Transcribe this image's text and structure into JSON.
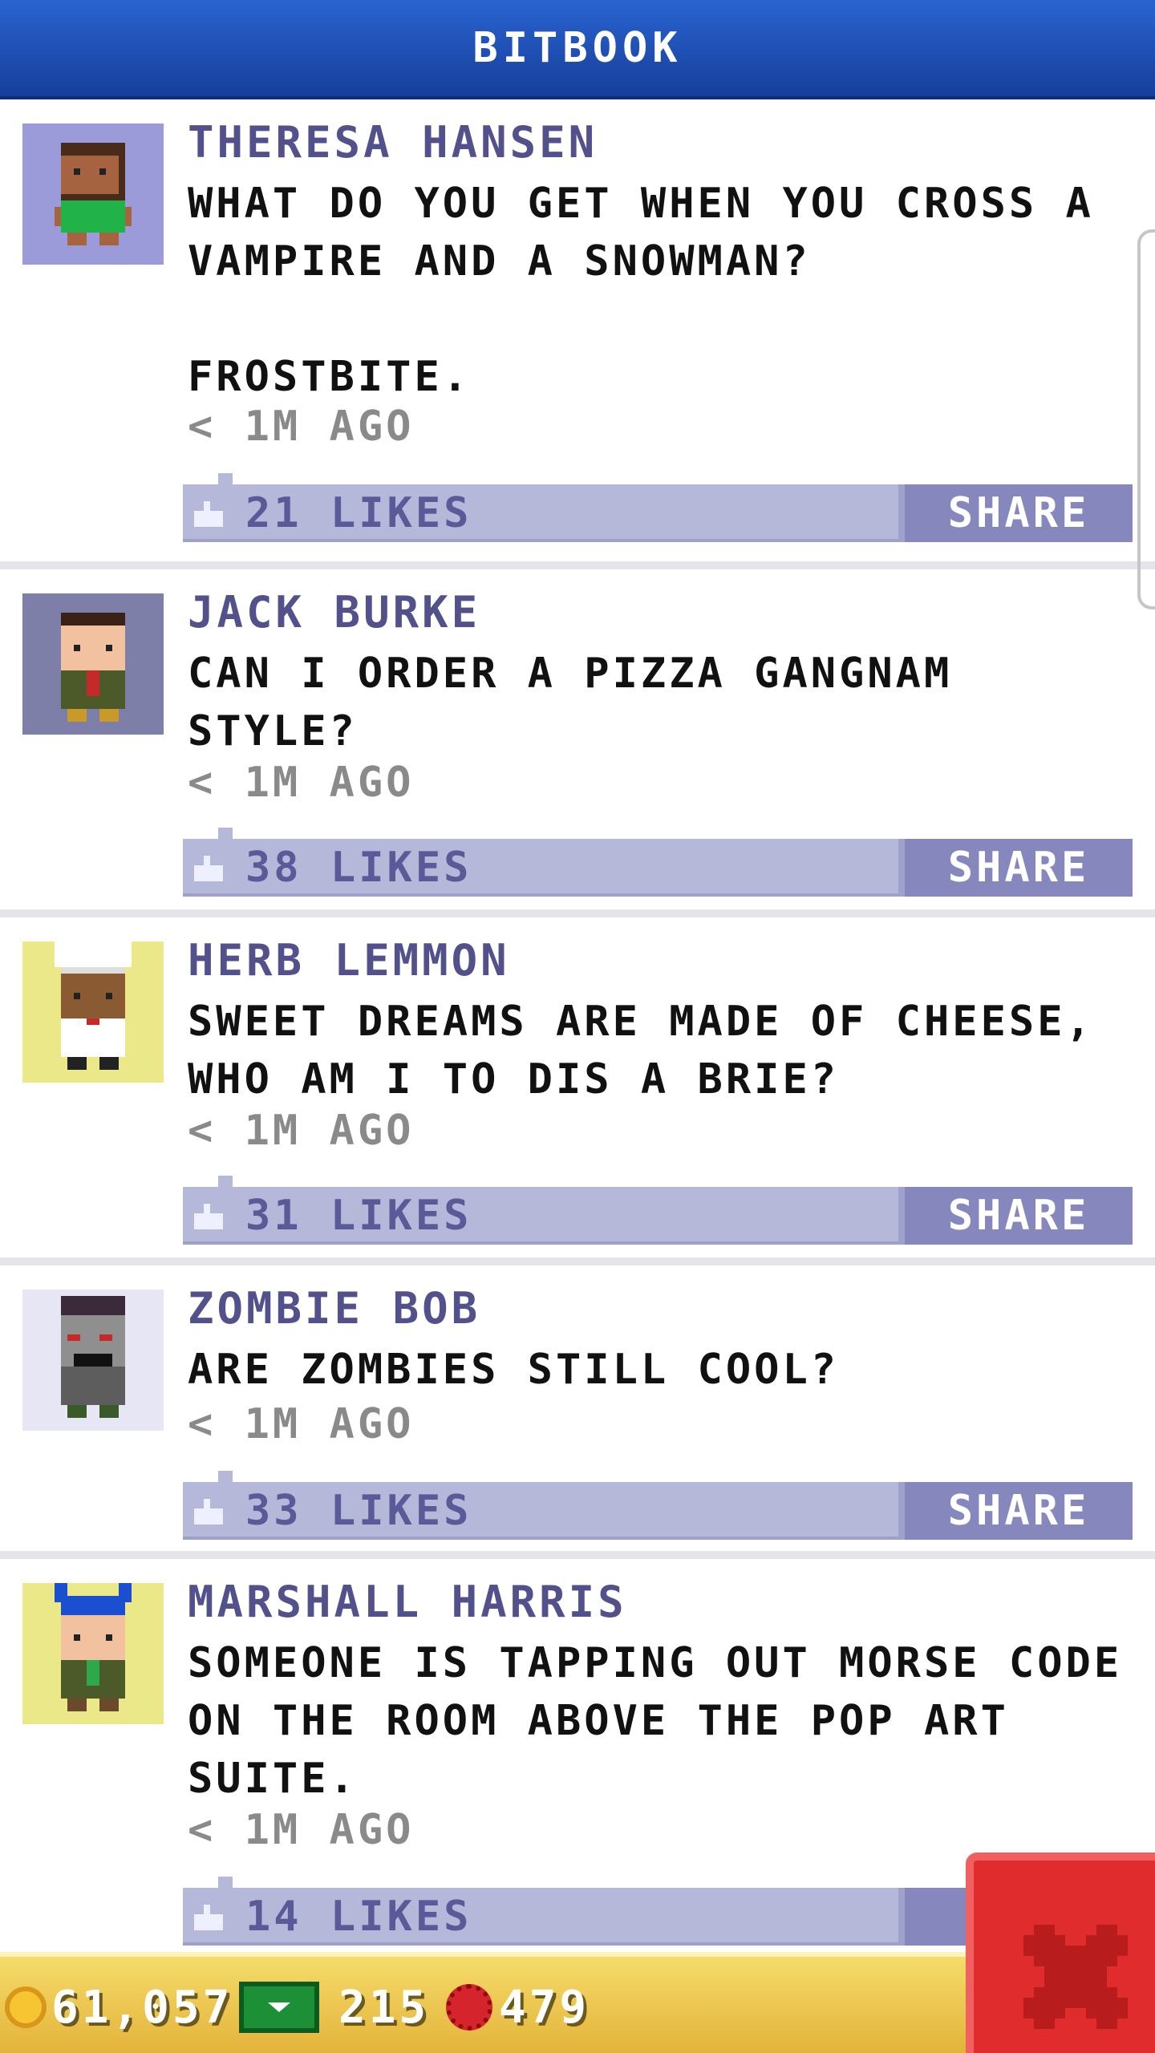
{
  "header": {
    "title": "BITBOOK"
  },
  "posts": [
    {
      "name": "THERESA HANSEN",
      "text": "WHAT DO YOU GET WHEN YOU CROSS A\nVAMPIRE AND A SNOWMAN?\n\nFROSTBITE.",
      "time": "< 1M AGO",
      "likes": "21 LIKES",
      "share": "SHARE"
    },
    {
      "name": "JACK BURKE",
      "text": "CAN I ORDER A PIZZA GANGNAM\nSTYLE?",
      "time": "< 1M AGO",
      "likes": "38 LIKES",
      "share": "SHARE"
    },
    {
      "name": "HERB LEMMON",
      "text": "SWEET DREAMS ARE MADE OF CHEESE,\nWHO AM I TO DIS A BRIE?",
      "time": "< 1M AGO",
      "likes": "31 LIKES",
      "share": "SHARE"
    },
    {
      "name": "ZOMBIE BOB",
      "text": "ARE ZOMBIES STILL COOL?",
      "time": "< 1M AGO",
      "likes": "33 LIKES",
      "share": "SHARE"
    },
    {
      "name": "MARSHALL HARRIS",
      "text": "SOMEONE IS TAPPING OUT MORSE CODE\nON THE ROOM ABOVE THE POP ART\nSUITE.",
      "time": "< 1M AGO",
      "likes": "14 LIKES",
      "share": "S"
    }
  ],
  "bottom_bar": {
    "coins": "61,057",
    "bux": "215",
    "gems": "479"
  },
  "icons": {
    "like": "thumbs-up-icon",
    "coin": "coin-icon",
    "bux": "bux-icon",
    "gem": "gem-icon",
    "close": "close-icon"
  },
  "colors": {
    "header": "#1e4fb8",
    "name": "#53518c",
    "like_bar": "#b6b8da",
    "share": "#8688bd",
    "bottom_bar": "#e8bd45",
    "close": "#e02c2c"
  }
}
